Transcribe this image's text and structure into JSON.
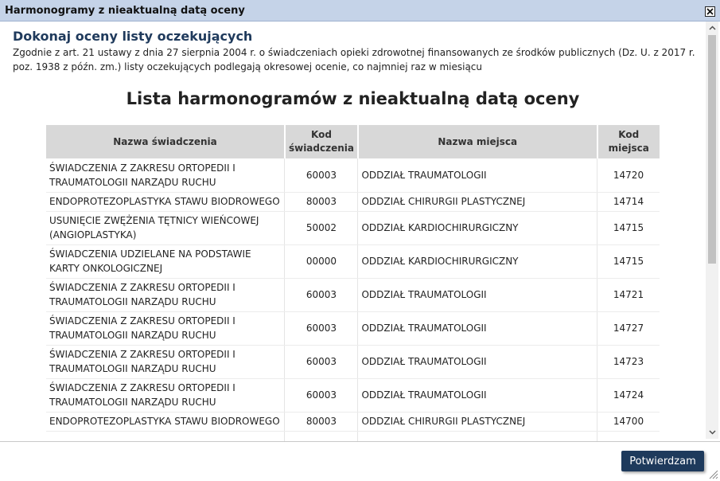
{
  "window": {
    "title": "Harmonogramy z nieaktualną datą oceny"
  },
  "content": {
    "heading": "Dokonaj oceny listy oczekujących",
    "description": "Zgodnie z art. 21 ustawy z dnia 27 sierpnia 2004 r. o świadczeniach opieki zdrowotnej finansowanych ze środków publicznych (Dz. U. z 2017 r. poz. 1938 z późn. zm.) listy oczekujących podlegają okresowej ocenie, co najmniej raz w miesiącu",
    "list_title": "Lista harmonogramów z nieaktualną datą oceny",
    "table": {
      "headers": {
        "service_name": "Nazwa świadczenia",
        "service_code": "Kod świadczenia",
        "place_name": "Nazwa miejsca",
        "place_code": "Kod miejsca"
      },
      "rows": [
        {
          "service_name": "ŚWIADCZENIA Z ZAKRESU ORTOPEDII I TRAUMATOLOGII NARZĄDU RUCHU",
          "service_code": "60003",
          "place_name": "ODDZIAŁ TRAUMATOLOGII",
          "place_code": "14720"
        },
        {
          "service_name": "ENDOPROTEZOPLASTYKA STAWU BIODROWEGO",
          "service_code": "80003",
          "place_name": "ODDZIAŁ CHIRURGII PLASTYCZNEJ",
          "place_code": "14714"
        },
        {
          "service_name": "USUNIĘCIE ZWĘŻENIA TĘTNICY WIEŃCOWEJ (ANGIOPLASTYKA)",
          "service_code": "50002",
          "place_name": "ODDZIAŁ KARDIOCHIRURGICZNY",
          "place_code": "14715"
        },
        {
          "service_name": "ŚWIADCZENIA UDZIELANE NA PODSTAWIE KARTY ONKOLOGICZNEJ",
          "service_code": "00000",
          "place_name": "ODDZIAŁ KARDIOCHIRURGICZNY",
          "place_code": "14715"
        },
        {
          "service_name": "ŚWIADCZENIA Z ZAKRESU ORTOPEDII I TRAUMATOLOGII NARZĄDU RUCHU",
          "service_code": "60003",
          "place_name": "ODDZIAŁ TRAUMATOLOGII",
          "place_code": "14721"
        },
        {
          "service_name": "ŚWIADCZENIA Z ZAKRESU ORTOPEDII I TRAUMATOLOGII NARZĄDU RUCHU",
          "service_code": "60003",
          "place_name": "ODDZIAŁ TRAUMATOLOGII",
          "place_code": "14727"
        },
        {
          "service_name": "ŚWIADCZENIA Z ZAKRESU ORTOPEDII I TRAUMATOLOGII NARZĄDU RUCHU",
          "service_code": "60003",
          "place_name": "ODDZIAŁ TRAUMATOLOGII",
          "place_code": "14723"
        },
        {
          "service_name": "ŚWIADCZENIA Z ZAKRESU ORTOPEDII I TRAUMATOLOGII NARZĄDU RUCHU",
          "service_code": "60003",
          "place_name": "ODDZIAŁ TRAUMATOLOGII",
          "place_code": "14724"
        },
        {
          "service_name": "ENDOPROTEZOPLASTYKA STAWU BIODROWEGO",
          "service_code": "80003",
          "place_name": "ODDZIAŁ CHIRURGII PLASTYCZNEJ",
          "place_code": "14700"
        }
      ]
    }
  },
  "footer": {
    "confirm_label": "Potwierdzam"
  },
  "colors": {
    "titlebar": "#c5d3e8",
    "heading": "#1f3a5c",
    "table_header": "#d8d8d8",
    "confirm_button": "#1e3a5c"
  },
  "icons": {
    "close": "close-icon",
    "scroll_up": "chevron-up-icon",
    "scroll_down": "chevron-down-icon",
    "resize": "resize-grip-icon"
  }
}
